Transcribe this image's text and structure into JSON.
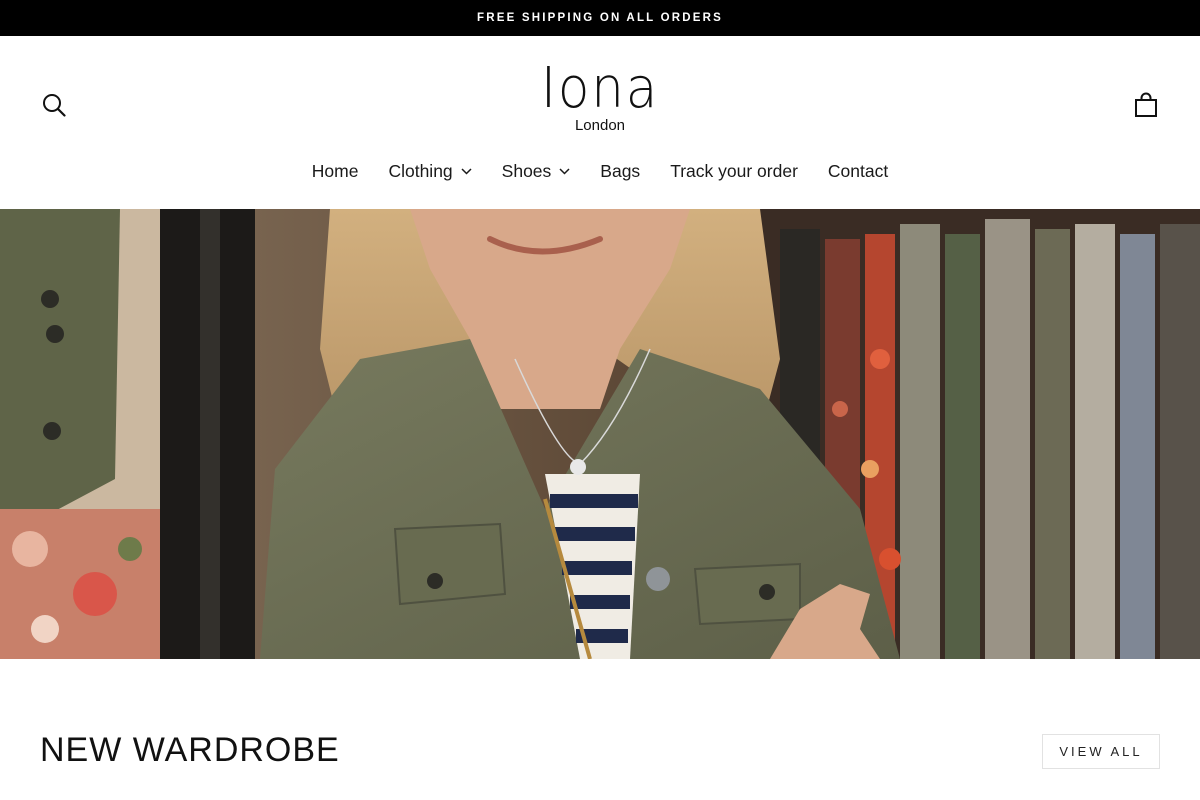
{
  "announcement": {
    "text": "FREE SHIPPING ON ALL ORDERS"
  },
  "header": {
    "logo": {
      "main": "Iona",
      "sub": "London"
    },
    "search_icon": "search-icon",
    "cart_icon": "shopping-bag-icon"
  },
  "nav": {
    "items": [
      {
        "label": "Home"
      },
      {
        "label": "Clothing",
        "has_dropdown": true
      },
      {
        "label": "Shoes",
        "has_dropdown": true
      },
      {
        "label": "Bags"
      },
      {
        "label": "Track your order"
      },
      {
        "label": "Contact"
      }
    ]
  },
  "hero": {
    "image": "woman-in-olive-jacket-with-arms-crossed-in-front-of-clothing-rail"
  },
  "collection": {
    "title": "NEW WARDROBE",
    "view_all_label": "VIEW ALL"
  },
  "colors": {
    "announcement_bg": "#000000",
    "announcement_text": "#ffffff",
    "page_bg": "#ffffff",
    "text": "#1a1a1a"
  }
}
